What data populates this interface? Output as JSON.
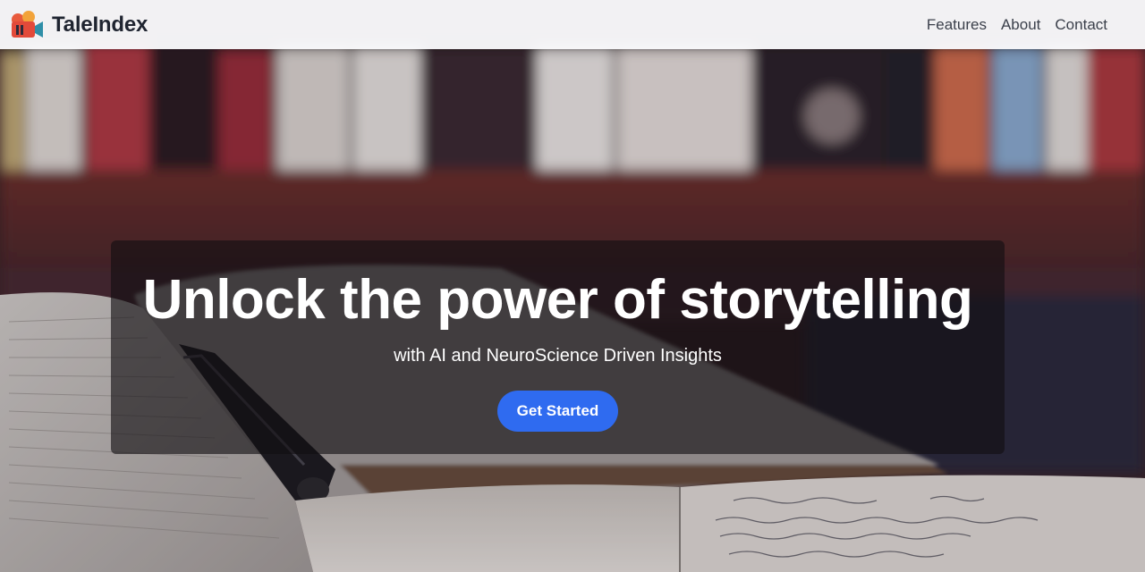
{
  "brand": {
    "name": "TaleIndex",
    "logo_icon": "book-reel-icon"
  },
  "nav": {
    "links": [
      {
        "label": "Features"
      },
      {
        "label": "About"
      },
      {
        "label": "Contact"
      }
    ]
  },
  "hero": {
    "title": "Unlock the power of storytelling",
    "subtitle": "with AI and NeuroScience Driven Insights",
    "cta_label": "Get Started"
  },
  "colors": {
    "accent": "#2f6bf0",
    "navbar_bg": "#fafafc",
    "card_bg": "rgba(18,14,18,0.62)"
  }
}
